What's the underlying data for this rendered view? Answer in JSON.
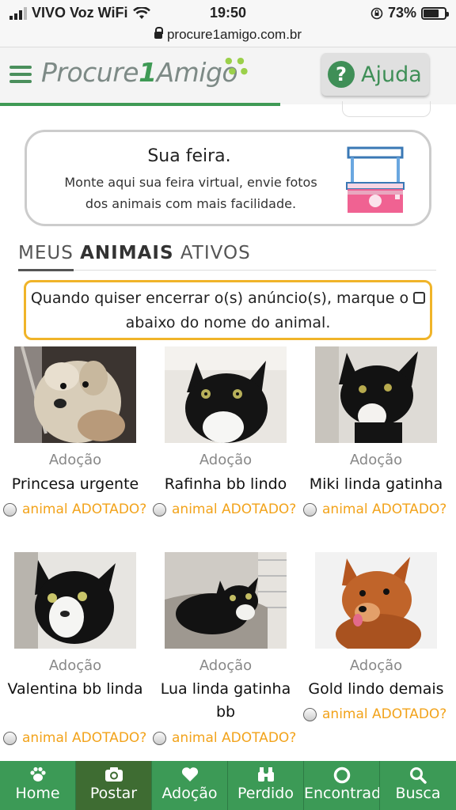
{
  "statusbar": {
    "carrier": "VIVO Voz WiFi",
    "time": "19:50",
    "battery": "73%",
    "battery_level": 0.73
  },
  "browser": {
    "url": "procure1amigo.com.br"
  },
  "header": {
    "logo_part1": "Procure",
    "logo_part2": "1",
    "logo_part3": "Amigo",
    "help_label": "Ajuda"
  },
  "feira": {
    "title": "Sua feira.",
    "text": "Monte aqui sua feira virtual, envie fotos dos animais com mais facilidade."
  },
  "section": {
    "title_part1": "MEUS ",
    "title_part2": "ANIMAIS",
    "title_part3": " ATIVOS"
  },
  "notice": {
    "text_before": "Quando quiser encerrar o(s) anúncio(s), marque o ",
    "text_after": " abaixo do nome do animal."
  },
  "animals": [
    {
      "kind": "Adoção",
      "name": "Princesa urgente",
      "adopted_label": "animal ADOTADO?"
    },
    {
      "kind": "Adoção",
      "name": "Rafinha bb lindo",
      "adopted_label": "animal ADOTADO?"
    },
    {
      "kind": "Adoção",
      "name": "Miki linda gatinha",
      "adopted_label": "animal ADOTADO?"
    },
    {
      "kind": "Adoção",
      "name": "Valentina bb linda",
      "adopted_label": "animal ADOTADO?"
    },
    {
      "kind": "Adoção",
      "name": "Lua linda gatinha bb",
      "adopted_label": "animal ADOTADO?"
    },
    {
      "kind": "Adoção",
      "name": "Gold lindo demais",
      "adopted_label": "animal ADOTADO?"
    }
  ],
  "nav": {
    "items": [
      {
        "label": "Home",
        "icon": "paw-icon"
      },
      {
        "label": "Postar",
        "icon": "camera-icon"
      },
      {
        "label": "Adoção",
        "icon": "heart-icon"
      },
      {
        "label": "Perdido",
        "icon": "binoculars-icon"
      },
      {
        "label": "Encontrado",
        "icon": "lifebuoy-icon"
      },
      {
        "label": "Busca",
        "icon": "search-icon"
      }
    ],
    "active": "Postar"
  },
  "colors": {
    "brand_green": "#3c9a56",
    "accent_orange": "#f2a31b",
    "notice_border": "#f0b429"
  }
}
